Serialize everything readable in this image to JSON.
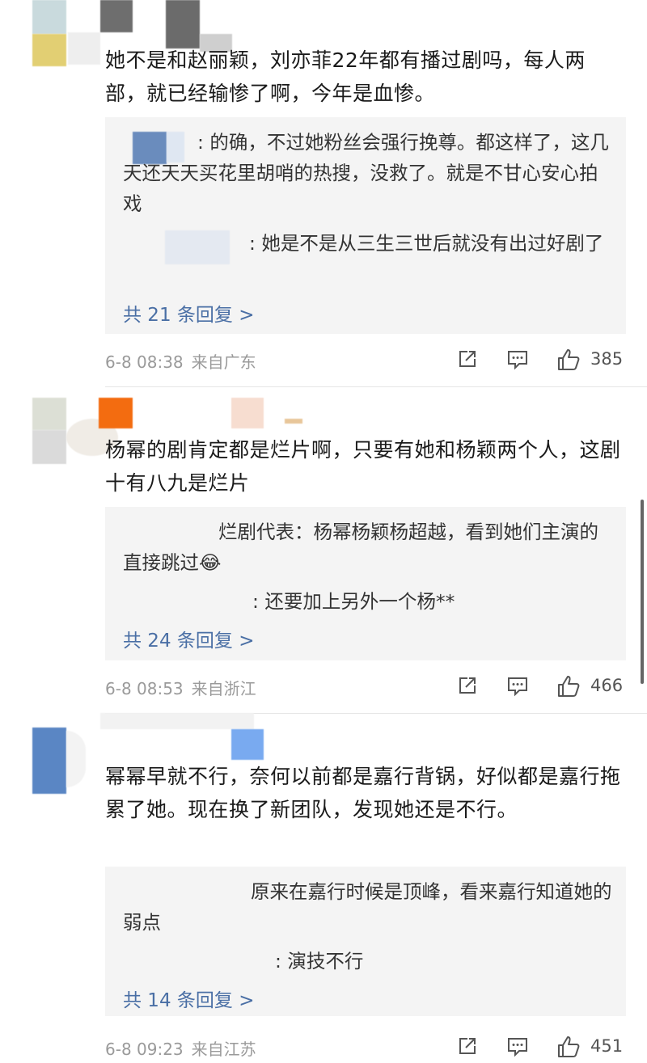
{
  "comments": [
    {
      "text": "她不是和赵丽颖，刘亦菲22年都有播过剧吗，每人两部，就已经输惨了啊，今年是血惨。",
      "replies": [
        {
          "text": ": 的确，不过她粉丝会强行挽尊。都这样了，这几天还天天买花里胡哨的热搜，没救了。就是不甘心安心拍戏"
        },
        {
          "text": ": 她是不是从三生三世后就没有出过好剧了"
        }
      ],
      "more": "共 21 条回复 >",
      "time": "6-8 08:38",
      "location": "来自广东",
      "likes": "385"
    },
    {
      "text": "杨幂的剧肯定都是烂片啊，只要有她和杨颖两个人，这剧十有八九是烂片",
      "replies": [
        {
          "text": "烂剧代表：杨幂杨颖杨超越，看到她们主演的直接跳过😂"
        },
        {
          "text": ": 还要加上另外一个杨**"
        }
      ],
      "more": "共 24 条回复 >",
      "time": "6-8 08:53",
      "location": "来自浙江",
      "likes": "466"
    },
    {
      "text": "幂幂早就不行，奈何以前都是嘉行背锅，好似都是嘉行拖累了她。现在换了新团队，发现她还是不行。",
      "replies": [
        {
          "text": "原来在嘉行时候是顶峰，看来嘉行知道她的弱点"
        },
        {
          "text": ": 演技不行"
        }
      ],
      "more": "共 14 条回复 >",
      "time": "6-8 09:23",
      "location": "来自江苏",
      "likes": "451"
    }
  ],
  "icons": {
    "share": "share-icon",
    "comment": "comment-icon",
    "like": "thumbs-up-icon"
  },
  "colors": {
    "link": "#4a6fa5",
    "meta": "#9a9a9a",
    "reply_bg": "#f4f4f4"
  }
}
